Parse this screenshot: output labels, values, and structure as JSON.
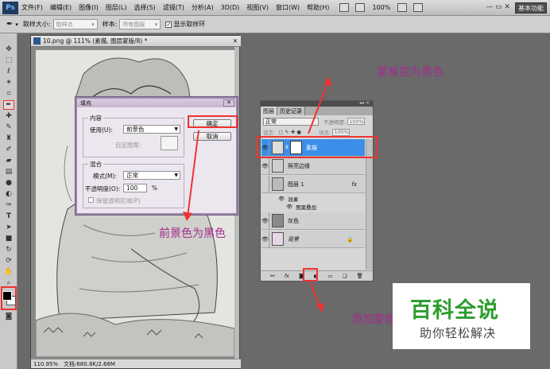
{
  "menubar": {
    "logo": "Ps",
    "items": [
      "文件(F)",
      "编辑(E)",
      "图像(I)",
      "图层(L)",
      "选择(S)",
      "滤镜(T)",
      "分析(A)",
      "3D(D)",
      "视图(V)",
      "窗口(W)",
      "帮助(H)"
    ],
    "zoom": "100%",
    "workspace_button": "基本功能"
  },
  "optionsbar": {
    "sample_size_label": "取样大小:",
    "sample_size_value": "取样点",
    "sample_label": "样本:",
    "sample_value": "所有图层",
    "show_ring_label": "显示取样环"
  },
  "document": {
    "tab_title": "10.png @ 111% (素描, 图层蒙版/8) *",
    "status_zoom": "110.95%",
    "status_doc": "文档:680.8K/2.66M"
  },
  "fill_dialog": {
    "title": "填充",
    "content_group": "内容",
    "use_label": "使用(U):",
    "use_value": "前景色",
    "custom_pattern_label": "自定图案:",
    "blending_group": "混合",
    "mode_label": "模式(M):",
    "mode_value": "正常",
    "opacity_label": "不透明度(O):",
    "opacity_value": "100",
    "opacity_unit": "%",
    "preserve_label": "保留透明区域(P)",
    "ok_label": "确定",
    "cancel_label": "取消"
  },
  "layers_panel": {
    "tabs": [
      "图层",
      "历史记录"
    ],
    "blend_mode": "正常",
    "opacity_label": "不透明度:",
    "opacity_value": "100%",
    "lock_label": "锁定:",
    "fill_label": "填充:",
    "fill_value": "100%",
    "layers": [
      {
        "name": "素描",
        "selected": true,
        "visible": true
      },
      {
        "name": "照亮边缘",
        "selected": false,
        "visible": true
      },
      {
        "name": "图层 1",
        "selected": false,
        "visible": false,
        "fx": "fx"
      },
      {
        "name": "灰色",
        "selected": false,
        "visible": true
      },
      {
        "name": "背景",
        "selected": false,
        "visible": true
      }
    ],
    "effects_label": "效果",
    "effect_name": "图案叠加",
    "bottom_icons": [
      "link-icon",
      "fx-icon",
      "add-mask-icon",
      "adjustment-icon",
      "group-icon",
      "new-layer-icon",
      "trash-icon"
    ]
  },
  "annotations": {
    "mask_black": "蒙板变为黑色",
    "fg_black": "前景色为黑色",
    "add_mask": "添加蒙板"
  },
  "badge": {
    "title": "百科全说",
    "subtitle": "助你轻松解决"
  },
  "colors": {
    "annotation_text": "#a32b8f",
    "highlight": "#e33333",
    "selected_layer": "#3c8fe8",
    "badge_green": "#2e9d2e"
  }
}
